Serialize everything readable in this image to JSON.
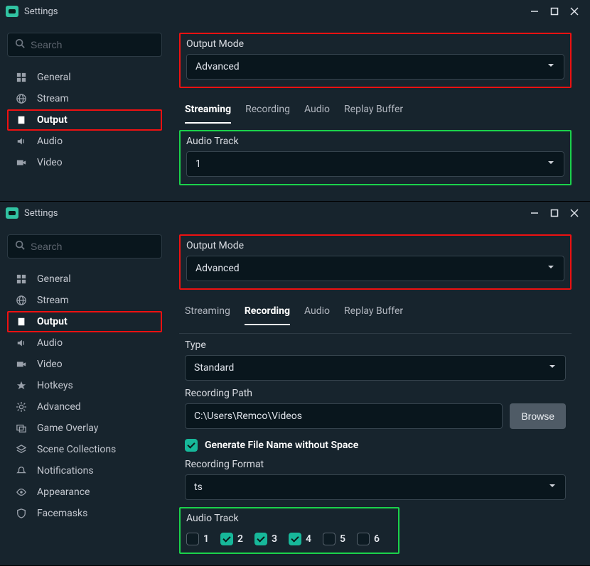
{
  "window_title": "Settings",
  "search_placeholder": "Search",
  "tabs": {
    "streaming": "Streaming",
    "recording": "Recording",
    "audio": "Audio",
    "replay": "Replay Buffer"
  },
  "output_mode_label": "Output Mode",
  "output_mode_value": "Advanced",
  "audio_track_label": "Audio Track",
  "audio_track_value_top": "1",
  "nav": {
    "general": "General",
    "stream": "Stream",
    "output": "Output",
    "audio": "Audio",
    "video": "Video",
    "hotkeys": "Hotkeys",
    "advanced": "Advanced",
    "game_overlay": "Game Overlay",
    "scene_collections": "Scene Collections",
    "notifications": "Notifications",
    "appearance": "Appearance",
    "facemasks": "Facemasks"
  },
  "recording": {
    "type_label": "Type",
    "type_value": "Standard",
    "path_label": "Recording Path",
    "path_value": "C:\\Users\\Remco\\Videos",
    "browse_label": "Browse",
    "gen_label": "Generate File Name without Space",
    "format_label": "Recording Format",
    "format_value": "ts"
  },
  "tracks": {
    "t1": "1",
    "t2": "2",
    "t3": "3",
    "t4": "4",
    "t5": "5",
    "t6": "6"
  }
}
